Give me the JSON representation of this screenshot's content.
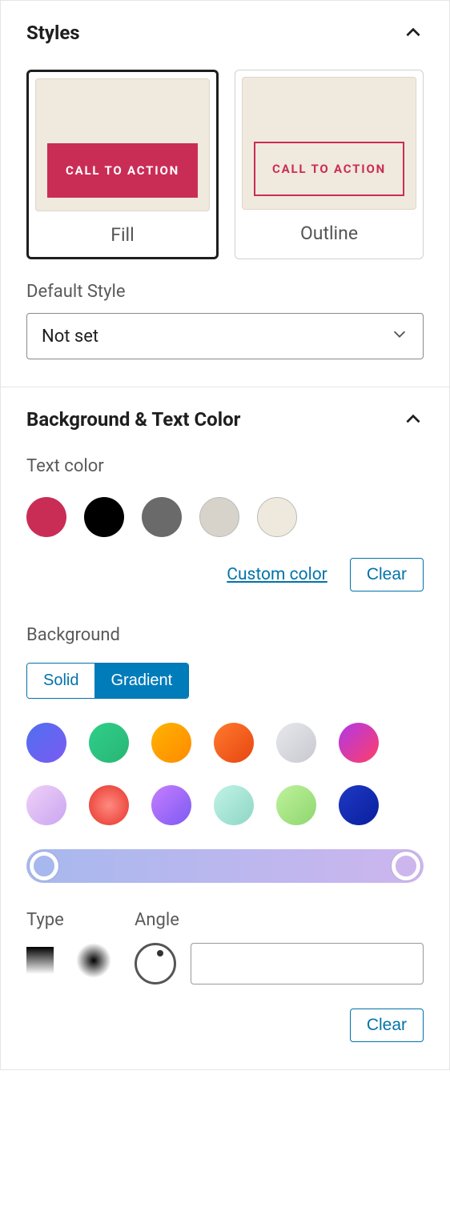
{
  "styles": {
    "title": "Styles",
    "cta_text": "CALL TO ACTION",
    "options": {
      "fill": "Fill",
      "outline": "Outline"
    },
    "default_style_label": "Default Style",
    "default_style_value": "Not set"
  },
  "bgtxt": {
    "title": "Background & Text Color",
    "text_color_label": "Text color",
    "text_colors": [
      "#c92d56",
      "#000000",
      "#6a6a6a",
      "#d7d3cb",
      "#efe9dd"
    ],
    "custom_color_label": "Custom color",
    "clear_label": "Clear",
    "background_label": "Background",
    "toggle": {
      "solid": "Solid",
      "gradient": "Gradient",
      "active": "gradient"
    },
    "gradients": [
      "linear-gradient(135deg,#4f6ff0,#7b5bf2)",
      "linear-gradient(135deg,#2ecf8a,#29b574)",
      "linear-gradient(135deg,#ffb300,#ff8a00)",
      "linear-gradient(135deg,#ff7a2e,#e74610)",
      "linear-gradient(135deg,#e8e8ec,#c7c9cf)",
      "linear-gradient(135deg,#b038e8,#ff3e68)",
      "linear-gradient(135deg,#f0d0f8,#c9a6f0)",
      "radial-gradient(circle,#ff8a80,#e6332a)",
      "linear-gradient(135deg,#c77dff,#7b5bf2)",
      "linear-gradient(135deg,#c0f3e6,#8fd6c5)",
      "linear-gradient(135deg,#bff29b,#8ed66e)",
      "linear-gradient(135deg,#1d39c4,#0b1f9e)"
    ],
    "gradient_bar": {
      "start": "#a7b8ee",
      "end": "#cdb6ee"
    },
    "type_label": "Type",
    "angle_label": "Angle",
    "angle_value": ""
  }
}
